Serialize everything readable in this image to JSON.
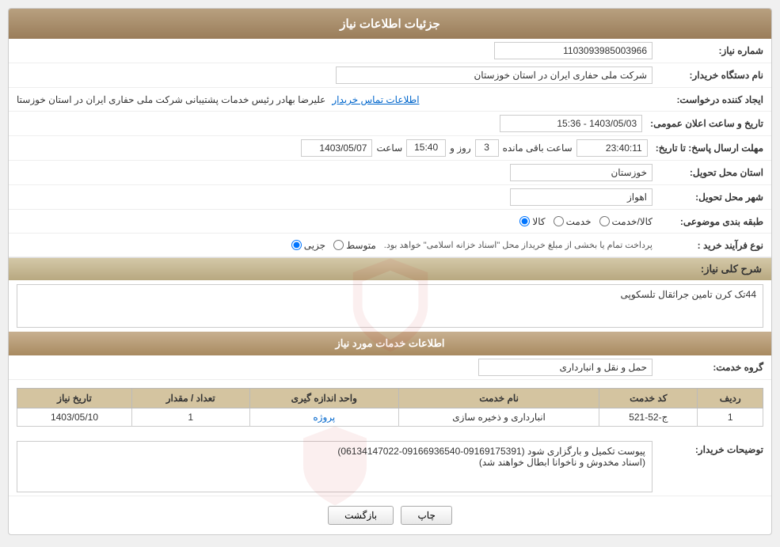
{
  "header": {
    "title": "جزئیات اطلاعات نیاز"
  },
  "fields": {
    "need_number_label": "شماره نیاز:",
    "need_number_value": "1103093985003966",
    "buyer_org_label": "نام دستگاه خریدار:",
    "buyer_org_value": "شرکت ملی حفاری ایران در استان خوزستان",
    "creator_label": "ایجاد کننده درخواست:",
    "creator_value": "علیرضا بهادر رئیس خدمات پشتیبانی شرکت ملی حفاری ایران در استان خوزستا",
    "contact_link": "اطلاعات تماس خریدار",
    "announce_time_label": "تاریخ و ساعت اعلان عمومی:",
    "announce_time_value": "1403/05/03 - 15:36",
    "response_deadline_label": "مهلت ارسال پاسخ: تا تاریخ:",
    "response_date": "1403/05/07",
    "response_time_label": "ساعت",
    "response_time": "15:40",
    "response_days_label": "روز و",
    "response_days": "3",
    "response_remaining_label": "ساعت باقی مانده",
    "response_remaining": "23:40:11",
    "delivery_province_label": "استان محل تحویل:",
    "delivery_province_value": "خوزستان",
    "delivery_city_label": "شهر محل تحویل:",
    "delivery_city_value": "اهواز",
    "category_label": "طبقه بندی موضوعی:",
    "category_options": [
      {
        "label": "کالا",
        "value": "kala"
      },
      {
        "label": "خدمت",
        "value": "khedmat"
      },
      {
        "label": "کالا/خدمت",
        "value": "kala_khedmat"
      }
    ],
    "category_selected": "kala",
    "purchase_type_label": "نوع فرآیند خرید :",
    "purchase_type_options": [
      {
        "label": "جزیی",
        "value": "jozyi"
      },
      {
        "label": "متوسط",
        "value": "motevaset"
      }
    ],
    "purchase_type_selected": "jozyi",
    "purchase_type_note": "پرداخت تمام یا بخشی از مبلغ خریداز محل \"اسناد خزانه اسلامی\" خواهد بود.",
    "need_summary_label": "شرح کلی نیاز:",
    "need_summary_value": "44تک کرن تامین جراثقال تلسکوپی",
    "services_section_header": "اطلاعات خدمات مورد نیاز",
    "service_group_label": "گروه خدمت:",
    "service_group_value": "حمل و نقل و انبارداری",
    "table_headers": [
      "ردیف",
      "کد خدمت",
      "نام خدمت",
      "واحد اندازه گیری",
      "تعداد / مقدار",
      "تاریخ نیاز"
    ],
    "table_rows": [
      {
        "row": "1",
        "code": "ج-52-521",
        "name": "انبارداری و ذخیره سازی",
        "unit": "پروژه",
        "quantity": "1",
        "date": "1403/05/10"
      }
    ],
    "buyer_notes_label": "توضیحات خریدار:",
    "buyer_notes_value": "پیوست تکمیل و بارگزاری شود (09169175391-09166936540-06134147022)\n(اسناد مخدوش و ناخوانا ابطال خواهند شد)",
    "btn_print": "چاپ",
    "btn_back": "بازگشت"
  }
}
